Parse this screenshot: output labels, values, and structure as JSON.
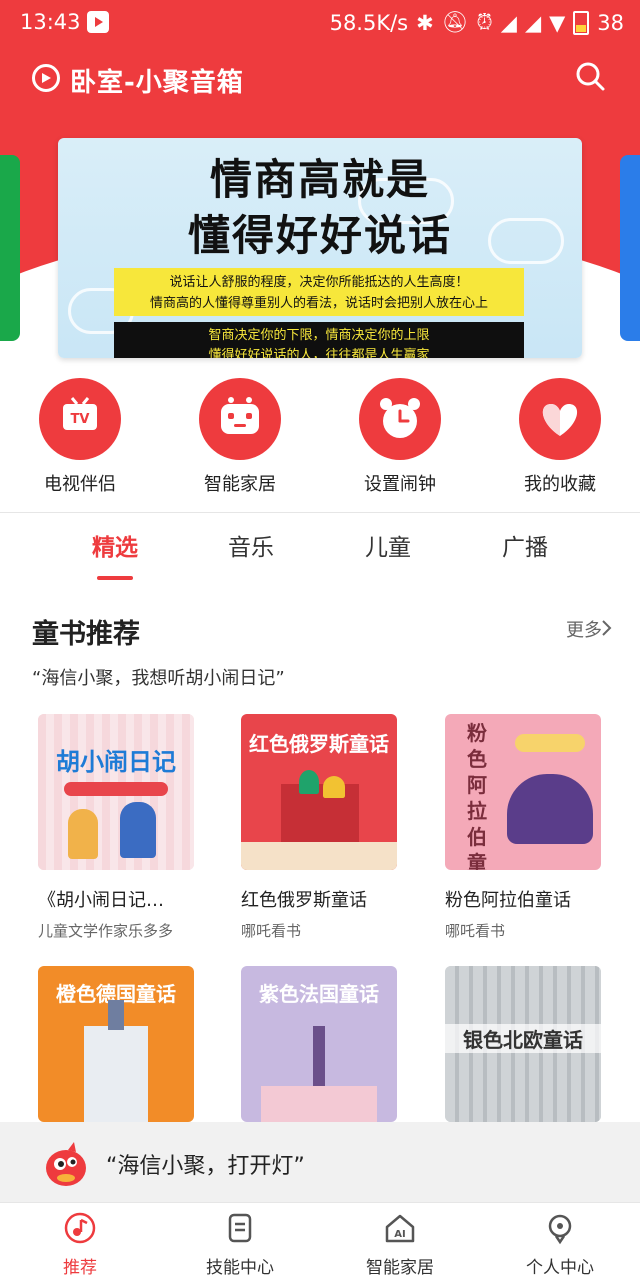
{
  "status_bar": {
    "time": "13:43",
    "network_speed": "58.5K/s",
    "battery": "38"
  },
  "header": {
    "title": "卧室-小聚音箱"
  },
  "banner": {
    "headline_line1": "情商高就是",
    "headline_line2": "懂得好好说话",
    "yellow_line1": "说话让人舒服的程度，决定你所能抵达的人生高度！",
    "yellow_line2": "情商高的人懂得尊重别人的看法，说话时会把别人放在心上",
    "black_line1": "智商决定你的下限，情商决定你的上限",
    "black_line2": "懂得好好说话的人，往往都是人生赢家"
  },
  "quick_actions": [
    {
      "label": "电视伴侣",
      "icon": "tv-icon"
    },
    {
      "label": "智能家居",
      "icon": "robot-icon"
    },
    {
      "label": "设置闹钟",
      "icon": "alarm-clock-icon"
    },
    {
      "label": "我的收藏",
      "icon": "heart-icon"
    }
  ],
  "tabs": [
    "精选",
    "音乐",
    "儿童",
    "广播"
  ],
  "section": {
    "title": "童书推荐",
    "more": "更多",
    "voice_hint": "“海信小聚，我想听胡小闹日记”"
  },
  "books": [
    {
      "title": "《胡小闹日记…",
      "author": "儿童文学作家乐多多",
      "cover_text": "胡小闹日记",
      "color": "#f6d8dc"
    },
    {
      "title": "红色俄罗斯童话",
      "author": "哪吒看书",
      "cover_text": "红色俄罗斯童话",
      "color": "#e8454b"
    },
    {
      "title": "粉色阿拉伯童话",
      "author": "哪吒看书",
      "cover_text": "粉色阿拉伯童话",
      "color": "#f4a9b8"
    },
    {
      "title": "橙色德国童话",
      "author": "",
      "cover_text": "橙色德国童话",
      "color": "#f28c28"
    },
    {
      "title": "紫色法国童话",
      "author": "",
      "cover_text": "紫色法国童话",
      "color": "#c7b9e0"
    },
    {
      "title": "银色北欧童话",
      "author": "",
      "cover_text": "银色北欧童话",
      "color": "#cfd3d6"
    }
  ],
  "voice_bar": {
    "text": "“海信小聚，打开灯”"
  },
  "bottom_nav": [
    {
      "label": "推荐",
      "icon": "music-note-icon",
      "active": true
    },
    {
      "label": "技能中心",
      "icon": "skill-icon",
      "active": false
    },
    {
      "label": "智能家居",
      "icon": "ai-home-icon",
      "active": false
    },
    {
      "label": "个人中心",
      "icon": "user-icon",
      "active": false
    }
  ],
  "colors": {
    "accent": "#ee3b3e"
  }
}
